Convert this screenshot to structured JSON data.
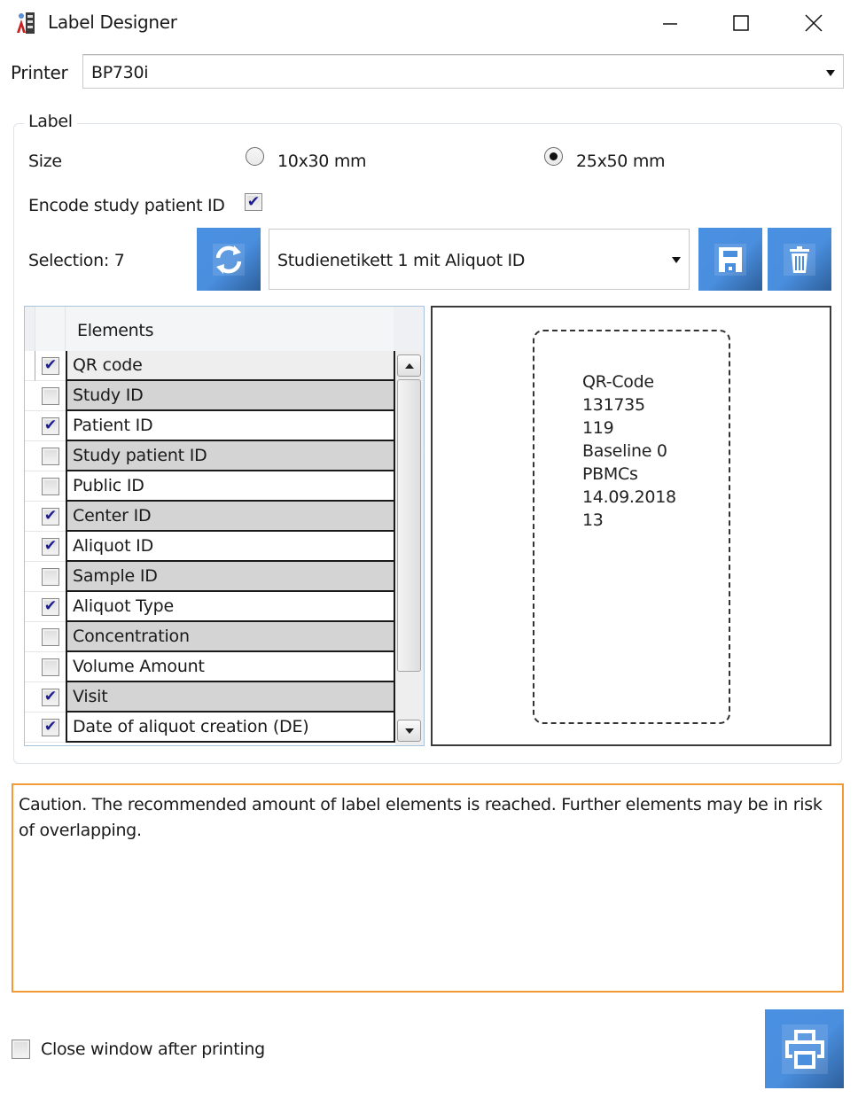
{
  "window": {
    "title": "Label Designer",
    "icon": "app-logo-icon",
    "controls": [
      "minimize-icon",
      "maximize-icon",
      "close-icon"
    ]
  },
  "printer": {
    "label": "Printer",
    "selected": "BP730i"
  },
  "label_group": {
    "legend": "Label",
    "size": {
      "label": "Size",
      "options": [
        {
          "label": "10x30 mm",
          "selected": false
        },
        {
          "label": "25x50 mm",
          "selected": true
        }
      ]
    },
    "encode_study_patient_id": {
      "label": "Encode study patient ID",
      "checked": true
    },
    "selection": {
      "label": "Selection: 7",
      "template_selected": "Studienetikett 1 mit Aliquot ID",
      "buttons": {
        "refresh": "refresh-icon",
        "save": "save-icon",
        "delete": "trash-icon"
      }
    },
    "elements_list": {
      "header": "Elements",
      "items": [
        {
          "label": "QR code",
          "checked": true
        },
        {
          "label": "Study ID",
          "checked": false
        },
        {
          "label": "Patient ID",
          "checked": true
        },
        {
          "label": "Study patient ID",
          "checked": false
        },
        {
          "label": "Public ID",
          "checked": false
        },
        {
          "label": "Center ID",
          "checked": true
        },
        {
          "label": "Aliquot ID",
          "checked": true
        },
        {
          "label": "Sample ID",
          "checked": false
        },
        {
          "label": "Aliquot Type",
          "checked": true
        },
        {
          "label": "Concentration",
          "checked": false
        },
        {
          "label": "Volume Amount",
          "checked": false
        },
        {
          "label": "Visit",
          "checked": true
        },
        {
          "label": "Date of aliquot creation (DE)",
          "checked": true
        }
      ]
    },
    "preview": {
      "lines": [
        "QR-Code",
        "131735",
        "119",
        "Baseline 0",
        "PBMCs",
        "14.09.2018",
        "13"
      ]
    }
  },
  "warning": {
    "text": "Caution. The recommended amount of label elements is reached. Further elements may be in risk of overlapping.",
    "border_color": "#f29b36"
  },
  "footer": {
    "close_after_print": {
      "label": "Close window after printing",
      "checked": false
    },
    "print_button": "printer-icon"
  },
  "colors": {
    "accent_blue": "#4a90e2",
    "warning_orange": "#f29b36",
    "alt_row": "#d4d4d4"
  }
}
